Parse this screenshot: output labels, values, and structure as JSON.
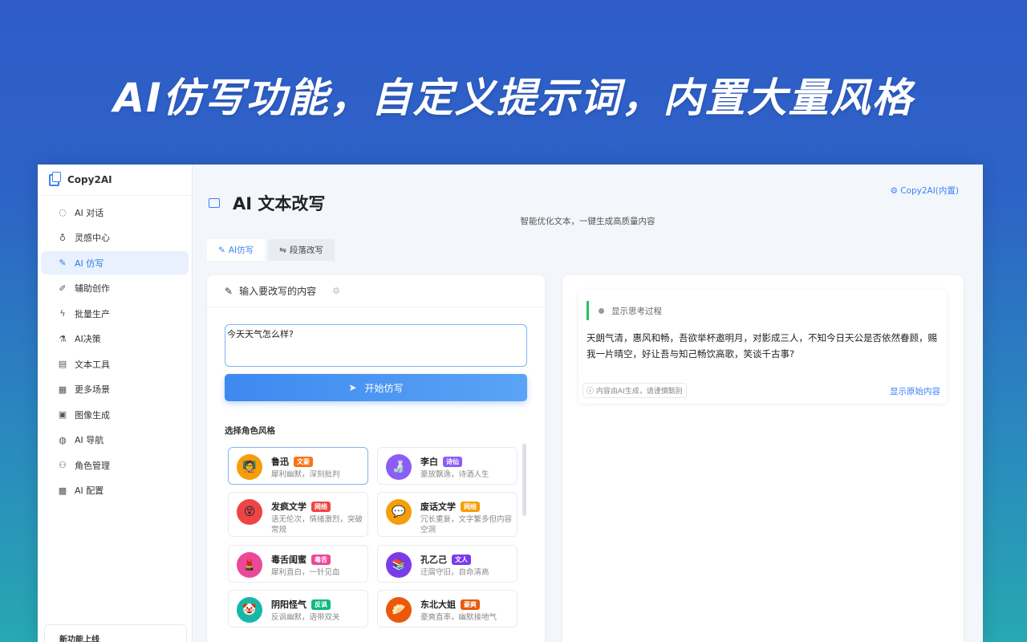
{
  "banner": "AI仿写功能，自定义提示词，内置大量风格",
  "app": {
    "name": "Copy2AI"
  },
  "sidebar": {
    "items": [
      {
        "label": "AI 对话",
        "icon": "chat-icon"
      },
      {
        "label": "灵感中心",
        "icon": "bulb-icon"
      },
      {
        "label": "AI 仿写",
        "icon": "pen-icon"
      },
      {
        "label": "辅助创作",
        "icon": "brush-icon"
      },
      {
        "label": "批量生产",
        "icon": "bolt-icon"
      },
      {
        "label": "AI决策",
        "icon": "flask-icon"
      },
      {
        "label": "文本工具",
        "icon": "doc-icon"
      },
      {
        "label": "更多场景",
        "icon": "grid-icon"
      },
      {
        "label": "图像生成",
        "icon": "image-icon"
      },
      {
        "label": "AI 导航",
        "icon": "globe-icon"
      },
      {
        "label": "角色管理",
        "icon": "users-icon"
      },
      {
        "label": "AI 配置",
        "icon": "config-icon"
      }
    ],
    "active_index": 2,
    "footer": "新功能上线"
  },
  "header": {
    "top_link": "Copy2AI(内置)",
    "title": "AI 文本改写",
    "subtitle": "智能优化文本，一键生成高质量内容"
  },
  "tabs": [
    {
      "label": "AI仿写",
      "active": true
    },
    {
      "label": "段落改写",
      "active": false
    }
  ],
  "left_panel": {
    "heading": "输入要改写的内容",
    "input_value": "今天天气怎么样?",
    "run_button": "开始仿写",
    "roles_label": "选择角色风格",
    "roles": [
      {
        "name": "鲁迅",
        "tag": "文豪",
        "tag_color": "#f97316",
        "desc": "犀利幽默，深刻批判",
        "emoji": "🧑‍🏫",
        "bg": "#f59e0b",
        "selected": true
      },
      {
        "name": "李白",
        "tag": "诗仙",
        "tag_color": "#8b5cf6",
        "desc": "豪放飘逸，诗酒人生",
        "emoji": "🍶",
        "bg": "#8b5cf6",
        "selected": false
      },
      {
        "name": "发疯文学",
        "tag": "网络",
        "tag_color": "#ef4444",
        "desc": "语无伦次，情绪激烈，突破常规",
        "emoji": "😵",
        "bg": "#ef4444",
        "selected": false
      },
      {
        "name": "废话文学",
        "tag": "网络",
        "tag_color": "#f59e0b",
        "desc": "冗长重复，文字繁多但内容空洞",
        "emoji": "💬",
        "bg": "#f59e0b",
        "selected": false
      },
      {
        "name": "毒舌闺蜜",
        "tag": "毒舌",
        "tag_color": "#ec4899",
        "desc": "犀利直白，一针见血",
        "emoji": "💄",
        "bg": "#ec4899",
        "selected": false
      },
      {
        "name": "孔乙己",
        "tag": "文人",
        "tag_color": "#7c3aed",
        "desc": "迂腐守旧，自命清高",
        "emoji": "📚",
        "bg": "#7c3aed",
        "selected": false
      },
      {
        "name": "阴阳怪气",
        "tag": "反讽",
        "tag_color": "#10b981",
        "desc": "反讽幽默，语带双关",
        "emoji": "🤡",
        "bg": "#14b8a6",
        "selected": false
      },
      {
        "name": "东北大姐",
        "tag": "豪爽",
        "tag_color": "#ea580c",
        "desc": "豪爽直率，幽默接地气",
        "emoji": "🥟",
        "bg": "#ea580c",
        "selected": false
      }
    ]
  },
  "right_panel": {
    "think_toggle": "显示思考过程",
    "result": "天朗气清，惠风和畅，吾欲举杯邀明月，对影成三人，不知今日天公是否依然眷顾，赐我一片晴空，好让吾与知己畅饮高歌，笑谈千古事?",
    "disclaimer": "内容由AI生成，请谨慎甄别",
    "show_original": "显示原始内容"
  }
}
